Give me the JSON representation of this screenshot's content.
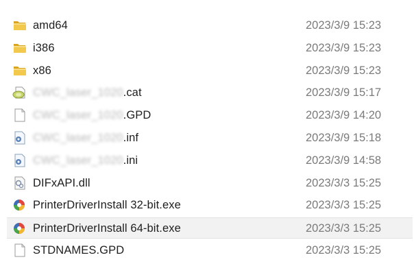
{
  "files": [
    {
      "name_prefix": "",
      "name_blur": "",
      "name_suffix": "amd64",
      "date": "2023/3/9 15:23",
      "icon": "folder-icon",
      "selected": false
    },
    {
      "name_prefix": "",
      "name_blur": "",
      "name_suffix": "i386",
      "date": "2023/3/9 15:23",
      "icon": "folder-icon",
      "selected": false
    },
    {
      "name_prefix": "",
      "name_blur": "",
      "name_suffix": "x86",
      "date": "2023/3/9 15:23",
      "icon": "folder-icon",
      "selected": false
    },
    {
      "name_prefix": "",
      "name_blur": "CWC_laser_1020",
      "name_suffix": ".cat",
      "date": "2023/3/9 15:17",
      "icon": "security-catalog-icon",
      "selected": false
    },
    {
      "name_prefix": "",
      "name_blur": "CWC_laser_1020",
      "name_suffix": ".GPD",
      "date": "2023/3/9 14:20",
      "icon": "blank-file-icon",
      "selected": false
    },
    {
      "name_prefix": "",
      "name_blur": "CWC_laser_1020",
      "name_suffix": ".inf",
      "date": "2023/3/9 15:18",
      "icon": "config-file-icon",
      "selected": false
    },
    {
      "name_prefix": "",
      "name_blur": "CWC_laser_1020",
      "name_suffix": ".ini",
      "date": "2023/3/9 14:58",
      "icon": "config-file-icon",
      "selected": false
    },
    {
      "name_prefix": "",
      "name_blur": "",
      "name_suffix": "DIFxAPI.dll",
      "date": "2023/3/3 15:25",
      "icon": "dll-file-icon",
      "selected": false
    },
    {
      "name_prefix": "",
      "name_blur": "",
      "name_suffix": "PrinterDriverInstall 32-bit.exe",
      "date": "2023/3/3 15:25",
      "icon": "installer-icon",
      "selected": false
    },
    {
      "name_prefix": "",
      "name_blur": "",
      "name_suffix": "PrinterDriverInstall 64-bit.exe",
      "date": "2023/3/3 15:25",
      "icon": "installer-icon",
      "selected": true
    },
    {
      "name_prefix": "",
      "name_blur": "",
      "name_suffix": "STDNAMES.GPD",
      "date": "2023/3/3 15:25",
      "icon": "blank-file-icon",
      "selected": false
    }
  ],
  "colors": {
    "folder": "#e8b83c",
    "selected_bg": "#f2f2f2",
    "date_text": "#7a7a7a"
  }
}
